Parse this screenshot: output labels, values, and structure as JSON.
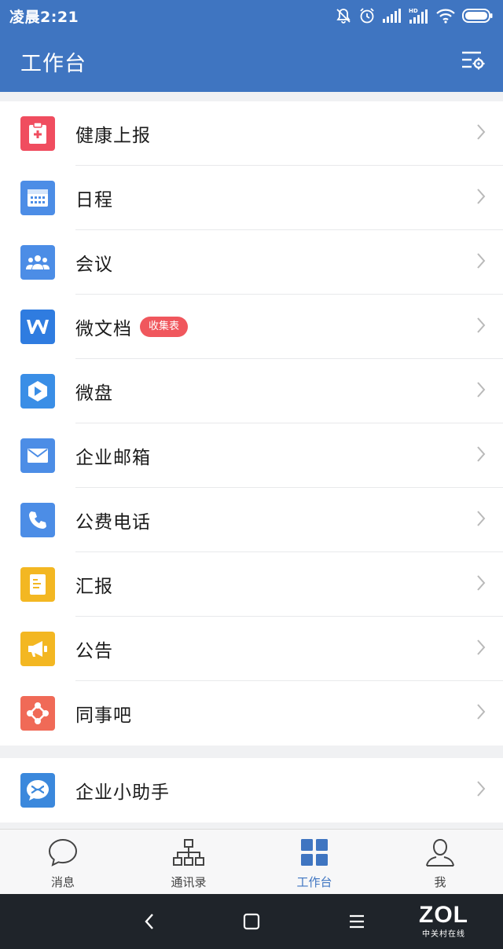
{
  "status_bar": {
    "time": "凌晨2:21",
    "icons": [
      "bell-off-icon",
      "alarm-icon",
      "signal-icon",
      "hd-signal-icon",
      "wifi-icon",
      "battery-icon"
    ]
  },
  "header": {
    "title": "工作台",
    "settings_icon": "list-settings-icon"
  },
  "apps": [
    {
      "label": "健康上报",
      "icon": "health-report-icon",
      "color": "#f04d5f"
    },
    {
      "label": "日程",
      "icon": "calendar-icon",
      "color": "#4c8de6"
    },
    {
      "label": "会议",
      "icon": "meeting-icon",
      "color": "#4c8de6"
    },
    {
      "label": "微文档",
      "icon": "doc-w-icon",
      "color": "#2f7ce0",
      "badge": "收集表"
    },
    {
      "label": "微盘",
      "icon": "drive-icon",
      "color": "#3a8ee6"
    },
    {
      "label": "企业邮箱",
      "icon": "mail-icon",
      "color": "#4c8de6"
    },
    {
      "label": "公费电话",
      "icon": "phone-icon",
      "color": "#4c8de6"
    },
    {
      "label": "汇报",
      "icon": "report-icon",
      "color": "#f3b722"
    },
    {
      "label": "公告",
      "icon": "announcement-icon",
      "color": "#f3b722"
    },
    {
      "label": "同事吧",
      "icon": "colleague-icon",
      "color": "#f06a57"
    }
  ],
  "assistant": {
    "label": "企业小助手",
    "icon": "assistant-icon",
    "color": "#3b88dc"
  },
  "tabs": [
    {
      "label": "消息",
      "icon": "message-icon",
      "active": false
    },
    {
      "label": "通讯录",
      "icon": "contacts-icon",
      "active": false
    },
    {
      "label": "工作台",
      "icon": "workbench-icon",
      "active": true
    },
    {
      "label": "我",
      "icon": "profile-icon",
      "active": false
    }
  ],
  "watermark": {
    "logo": "ZOL",
    "sub": "中关村在线"
  }
}
